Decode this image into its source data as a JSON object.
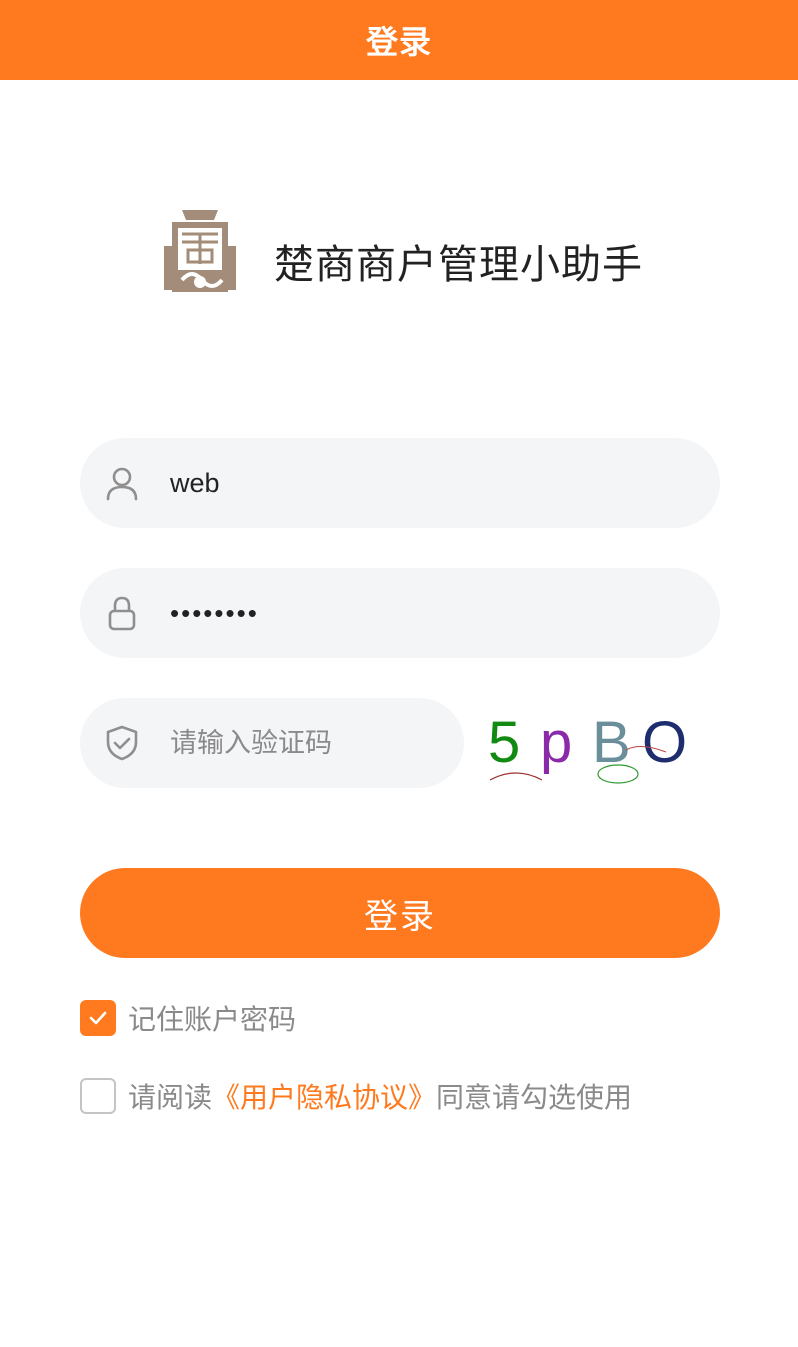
{
  "header": {
    "title": "登录"
  },
  "brand": {
    "name": "楚商商户管理小助手",
    "logo_icon": "chushang-logo-icon"
  },
  "form": {
    "username": {
      "value": "web",
      "icon": "user-icon"
    },
    "password": {
      "masked_value": "••••••••",
      "icon": "lock-icon"
    },
    "captcha": {
      "placeholder": "请输入验证码",
      "icon": "shield-check-icon",
      "code": "5pBO"
    },
    "submit_label": "登录"
  },
  "options": {
    "remember": {
      "label": "记住账户密码",
      "checked": true
    },
    "agreement": {
      "prefix": "请阅读",
      "link": "《用户隐私协议》",
      "suffix": "同意请勾选使用",
      "checked": false
    }
  },
  "colors": {
    "accent": "#ff7a1f",
    "field_bg": "#f4f5f7",
    "muted_text": "#8a8a8a",
    "logo": "#a38d7a"
  }
}
